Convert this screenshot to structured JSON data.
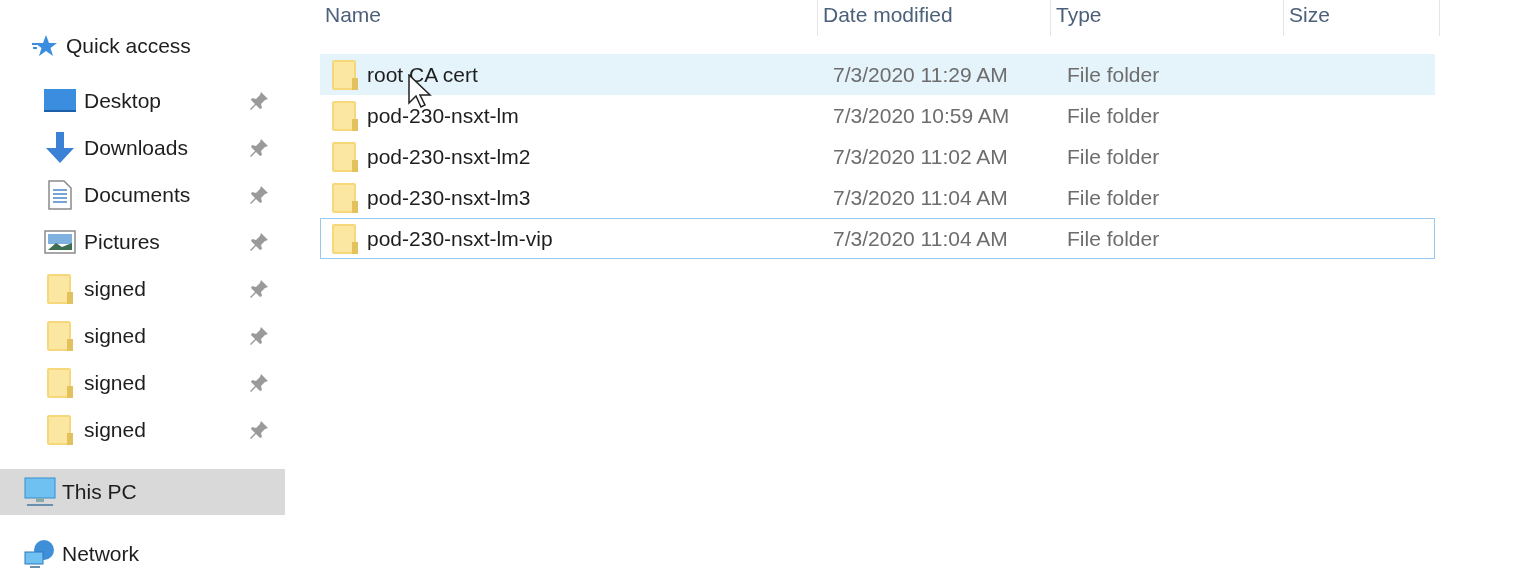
{
  "navigation": {
    "quick_access": {
      "label": "Quick access"
    },
    "items": [
      {
        "kind": "desktop",
        "label": "Desktop",
        "pinned": true
      },
      {
        "kind": "downloads",
        "label": "Downloads",
        "pinned": true
      },
      {
        "kind": "documents",
        "label": "Documents",
        "pinned": true
      },
      {
        "kind": "pictures",
        "label": "Pictures",
        "pinned": true
      },
      {
        "kind": "folder",
        "label": "signed",
        "pinned": true
      },
      {
        "kind": "folder",
        "label": "signed",
        "pinned": true
      },
      {
        "kind": "folder",
        "label": "signed",
        "pinned": true
      },
      {
        "kind": "folder",
        "label": "signed",
        "pinned": true
      }
    ],
    "locations": [
      {
        "kind": "pc",
        "label": "This PC",
        "selected": true
      },
      {
        "kind": "network",
        "label": "Network",
        "selected": false
      }
    ]
  },
  "file_list": {
    "columns": [
      "Name",
      "Date modified",
      "Type",
      "Size"
    ],
    "rows": [
      {
        "name": "root CA cert",
        "date_modified": "7/3/2020 11:29 AM",
        "type": "File folder",
        "hovered": true,
        "focused": false
      },
      {
        "name": "pod-230-nsxt-lm",
        "date_modified": "7/3/2020 10:59 AM",
        "type": "File folder",
        "hovered": false,
        "focused": false
      },
      {
        "name": "pod-230-nsxt-lm2",
        "date_modified": "7/3/2020 11:02 AM",
        "type": "File folder",
        "hovered": false,
        "focused": false
      },
      {
        "name": "pod-230-nsxt-lm3",
        "date_modified": "7/3/2020 11:04 AM",
        "type": "File folder",
        "hovered": false,
        "focused": false
      },
      {
        "name": "pod-230-nsxt-lm-vip",
        "date_modified": "7/3/2020 11:04 AM",
        "type": "File folder",
        "hovered": false,
        "focused": true
      }
    ]
  }
}
